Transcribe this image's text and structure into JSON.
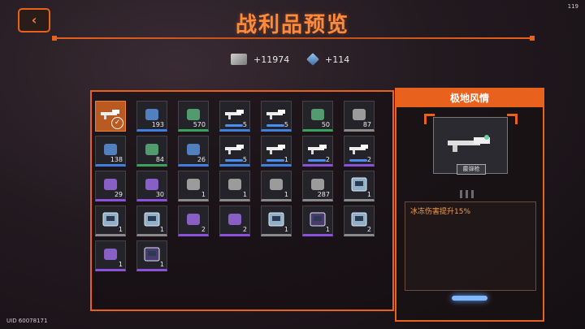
{
  "fps": "119",
  "title": "战利品预览",
  "currencies": [
    {
      "name": "cash-icon",
      "value": "+11974",
      "color": "#b8b8b8"
    },
    {
      "name": "cube-icon",
      "value": "+114",
      "color": "#5aa0e0"
    }
  ],
  "items": [
    {
      "icon": "rifle-icon",
      "qty": "",
      "rarity": "orange",
      "selected": true
    },
    {
      "icon": "plate-icon",
      "qty": "193",
      "rarity": "blue"
    },
    {
      "icon": "card-icon",
      "qty": "570",
      "rarity": "green"
    },
    {
      "icon": "rifle-icon",
      "qty": "5",
      "rarity": "blue",
      "bar": true
    },
    {
      "icon": "rifle-icon",
      "qty": "5",
      "rarity": "blue",
      "bar": true
    },
    {
      "icon": "plate-icon",
      "qty": "50",
      "rarity": "green"
    },
    {
      "icon": "armor-icon",
      "qty": "87",
      "rarity": "gray"
    },
    {
      "icon": "wrench-icon",
      "qty": "138",
      "rarity": "blue"
    },
    {
      "icon": "battery-icon",
      "qty": "84",
      "rarity": "green"
    },
    {
      "icon": "ring-icon",
      "qty": "26",
      "rarity": "blue"
    },
    {
      "icon": "rifle-icon",
      "qty": "5",
      "rarity": "blue",
      "bar": true
    },
    {
      "icon": "rifle-icon",
      "qty": "1",
      "rarity": "blue",
      "bar": true
    },
    {
      "icon": "rifle-icon",
      "qty": "2",
      "rarity": "purple",
      "bar": true
    },
    {
      "icon": "rifle-icon",
      "qty": "2",
      "rarity": "purple",
      "bar": true
    },
    {
      "icon": "core-icon",
      "qty": "29",
      "rarity": "purple"
    },
    {
      "icon": "crystal-icon",
      "qty": "30",
      "rarity": "purple"
    },
    {
      "icon": "chip-icon",
      "qty": "1",
      "rarity": "gray"
    },
    {
      "icon": "blade-icon",
      "qty": "1",
      "rarity": "gray"
    },
    {
      "icon": "blade-icon",
      "qty": "1",
      "rarity": "gray"
    },
    {
      "icon": "ore-icon",
      "qty": "287",
      "rarity": "gray"
    },
    {
      "icon": "box-icon",
      "qty": "1",
      "rarity": "gray"
    },
    {
      "icon": "box-icon",
      "qty": "1",
      "rarity": "gray"
    },
    {
      "icon": "box-icon",
      "qty": "1",
      "rarity": "gray"
    },
    {
      "icon": "belt-icon",
      "qty": "2",
      "rarity": "purple"
    },
    {
      "icon": "belt-icon",
      "qty": "2",
      "rarity": "purple"
    },
    {
      "icon": "box-icon",
      "qty": "1",
      "rarity": "gray"
    },
    {
      "icon": "dark-box-icon",
      "qty": "1",
      "rarity": "purple"
    },
    {
      "icon": "box-icon",
      "qty": "2",
      "rarity": "gray"
    },
    {
      "icon": "blueprint-icon",
      "qty": "1",
      "rarity": "purple"
    },
    {
      "icon": "dark-box-icon",
      "qty": "1",
      "rarity": "purple"
    }
  ],
  "side": {
    "header": "极地风情",
    "weapon_label": "霰弹枪",
    "description": "冰冻伤害提升15%"
  },
  "uid": "UID 60078171",
  "colors": {
    "accent": "#e8611d",
    "title": "#ff8a3a"
  }
}
